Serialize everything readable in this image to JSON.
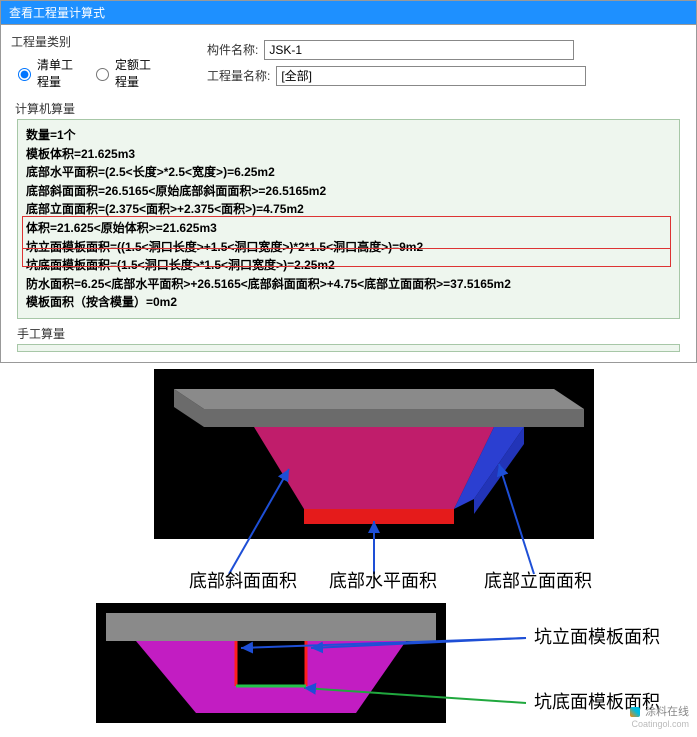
{
  "window": {
    "title": "查看工程量计算式"
  },
  "header": {
    "qtyTypeLabel": "工程量类别",
    "radio1": "清单工程量",
    "radio2": "定额工程量",
    "fieldLabels": {
      "component": "构件名称:",
      "project": "工程量名称:"
    },
    "fieldValues": {
      "component": "JSK-1",
      "project": "[全部]"
    }
  },
  "sections": {
    "calcTitle": "计算机算量",
    "handTitle": "手工算量"
  },
  "calc": {
    "lines": [
      "数量=1个",
      "模板体积=21.625m3",
      "底部水平面积=(2.5<长度>*2.5<宽度>)=6.25m2",
      "底部斜面面积=26.5165<原始底部斜面面积>=26.5165m2",
      "底部立面面积=(2.375<面积>+2.375<面积>)=4.75m2",
      "体积=21.625<原始体积>=21.625m3",
      "坑立面模板面积=((1.5<洞口长度>+1.5<洞口宽度>)*2*1.5<洞口高度>)=9m2",
      "坑底面模板面积=(1.5<洞口长度>*1.5<洞口宽度>)=2.25m2",
      "防水面积=6.25<底部水平面积>+26.5165<底部斜面面积>+4.75<底部立面面积>=37.5165m2",
      "模板面积（按含模量）=0m2"
    ]
  },
  "diagram1": {
    "labels": {
      "slant": "底部斜面面积",
      "horiz": "底部水平面积",
      "vert": "底部立面面积"
    }
  },
  "diagram2": {
    "labels": {
      "side": "坑立面模板面积",
      "bottom": "坑底面模板面积"
    }
  },
  "watermark": "涂料在线",
  "watermark_url": "Coatingol.com"
}
